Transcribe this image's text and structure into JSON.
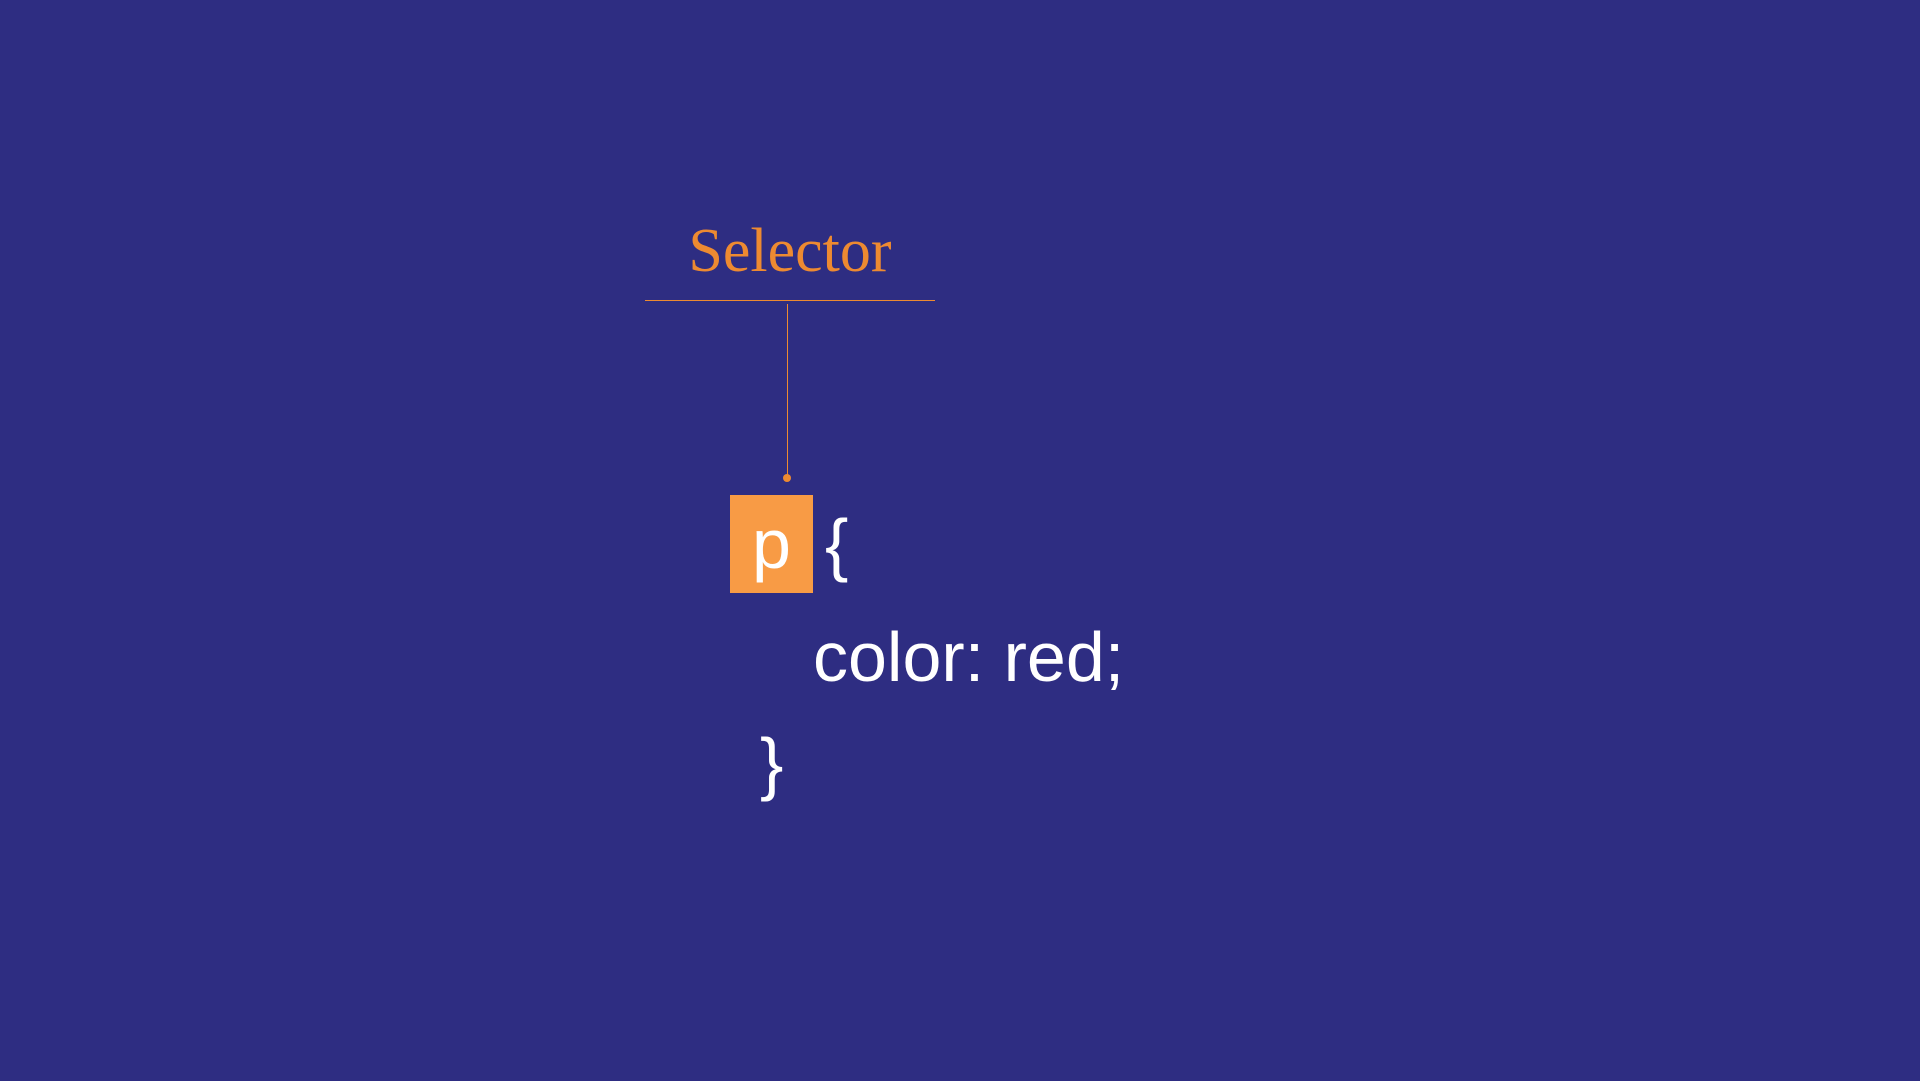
{
  "annotation": {
    "label": "Selector"
  },
  "code": {
    "selector": "p",
    "brace_open": "{",
    "declaration": "color: red;",
    "brace_close": "}"
  },
  "colors": {
    "background": "#2e2d82",
    "accent": "#ed8a31",
    "highlight": "#f89b45",
    "text": "#ffffff"
  }
}
